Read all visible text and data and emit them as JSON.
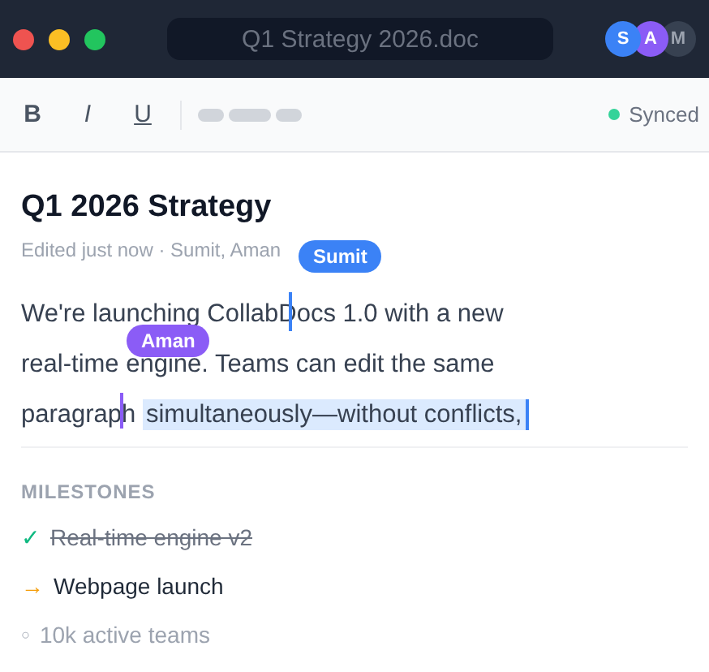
{
  "window": {
    "title": "Q1 Strategy 2026.doc"
  },
  "avatars": [
    {
      "initial": "S",
      "color": "#3b82f6"
    },
    {
      "initial": "A",
      "color": "#8b5cf6"
    },
    {
      "initial": "M",
      "color": "#374151"
    }
  ],
  "toolbar": {
    "buttons": [
      {
        "label": "B",
        "kind": "bold"
      },
      {
        "label": "I",
        "kind": "italic"
      },
      {
        "label": "U",
        "kind": "underline"
      }
    ],
    "status": "Synced"
  },
  "document": {
    "title": "Q1 2026 Strategy",
    "meta": "Edited just now · Sumit, Aman",
    "body": "We're launching CollabDocs 1.0 with a new real-time engine. Teams can edit the same paragraph ",
    "selection": "simultaneously—without conflicts,"
  },
  "cursors": [
    {
      "name": "Sumit",
      "color": "#3b82f6"
    },
    {
      "name": "Aman",
      "color": "#8b5cf6"
    }
  ],
  "milestones": {
    "heading": "MILESTONES",
    "items": [
      {
        "kind": "done",
        "marker": "✓",
        "label": "Real-time engine v2"
      },
      {
        "kind": "current",
        "marker": "→",
        "label": "Webpage launch"
      },
      {
        "kind": "pending",
        "marker": "○",
        "label": "10k active teams"
      }
    ]
  }
}
